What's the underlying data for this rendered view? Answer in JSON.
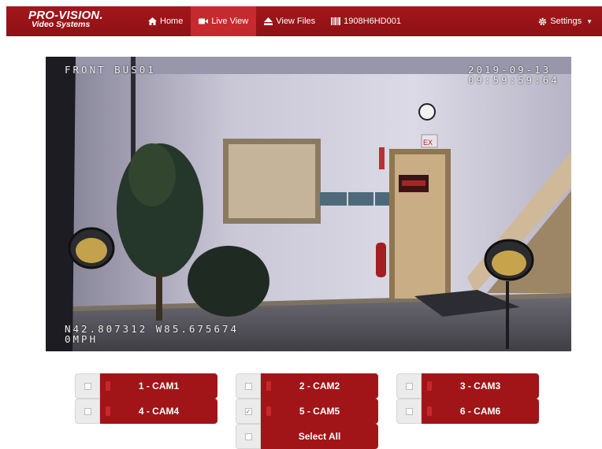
{
  "brand": {
    "name": "PRO-VISION.",
    "tagline": "Video Systems"
  },
  "nav": {
    "items": [
      {
        "label": "Home",
        "icon": "home-icon"
      },
      {
        "label": "Live View",
        "icon": "video-camera-icon",
        "active": true
      },
      {
        "label": "View Files",
        "icon": "eject-icon"
      },
      {
        "label": "1908H6HD001",
        "icon": "barcode-icon"
      }
    ],
    "settings_label": "Settings"
  },
  "video": {
    "camera_name": "FRONT BUS01",
    "date": "2019-09-13",
    "time": "09:59:59:64",
    "gps": "N42.807312 W85.675674",
    "speed": "0MPH"
  },
  "cameras": [
    {
      "label": "1 - CAM1",
      "checked": false
    },
    {
      "label": "2 - CAM2",
      "checked": false
    },
    {
      "label": "3 - CAM3",
      "checked": false
    },
    {
      "label": "4 - CAM4",
      "checked": false
    },
    {
      "label": "5 - CAM5",
      "checked": true
    },
    {
      "label": "6 - CAM6",
      "checked": false
    }
  ],
  "select_all_label": "Select All",
  "colors": {
    "nav_bg": "#9a1418",
    "nav_active": "#c62a2e",
    "button_red": "#a11519"
  }
}
